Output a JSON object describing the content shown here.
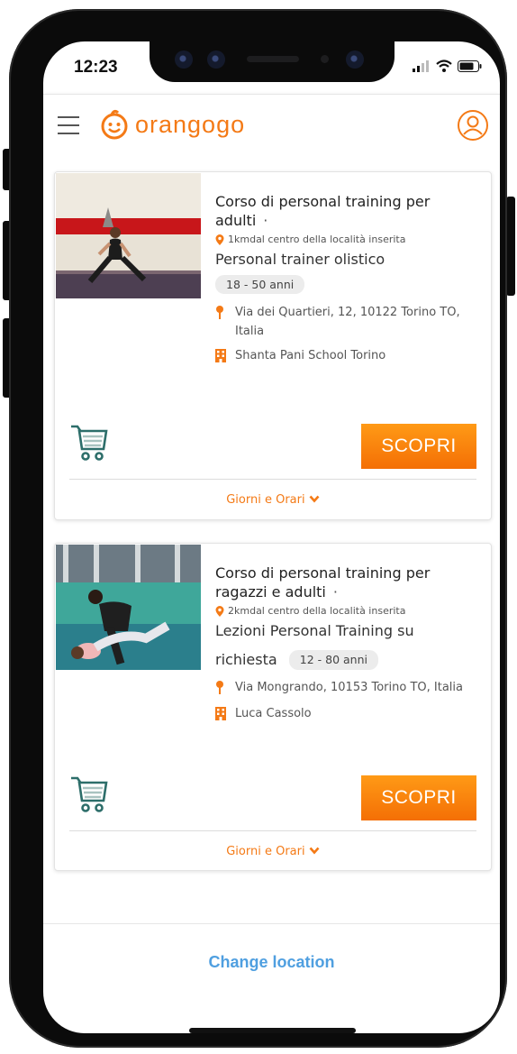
{
  "status": {
    "time": "12:23"
  },
  "header": {
    "brand": "orangogo"
  },
  "cards": [
    {
      "title": "Corso di personal training per adulti",
      "distance": "1kmdal centro della località inserita",
      "subtitle": "Personal trainer olistico",
      "age_badge": "18 - 50 anni",
      "address": "Via dei Quartieri, 12, 10122 Torino TO, Italia",
      "school": "Shanta Pani School Torino",
      "cta": "SCOPRI",
      "schedule_label": "Giorni e Orari"
    },
    {
      "title": "Corso di personal training per ragazzi e adulti",
      "distance": "2kmdal centro della località inserita",
      "subtitle": "Lezioni Personal Training su richiesta",
      "age_badge": "12 - 80 anni",
      "address": "Via Mongrando, 10153 Torino TO, Italia",
      "school": "Luca Cassolo",
      "cta": "SCOPRI",
      "schedule_label": "Giorni e Orari"
    }
  ],
  "footer": {
    "change_location": "Change location"
  },
  "colors": {
    "brand_orange": "#f47a16",
    "link_blue": "#4f9fe0",
    "cart_teal": "#2d6e6a"
  }
}
